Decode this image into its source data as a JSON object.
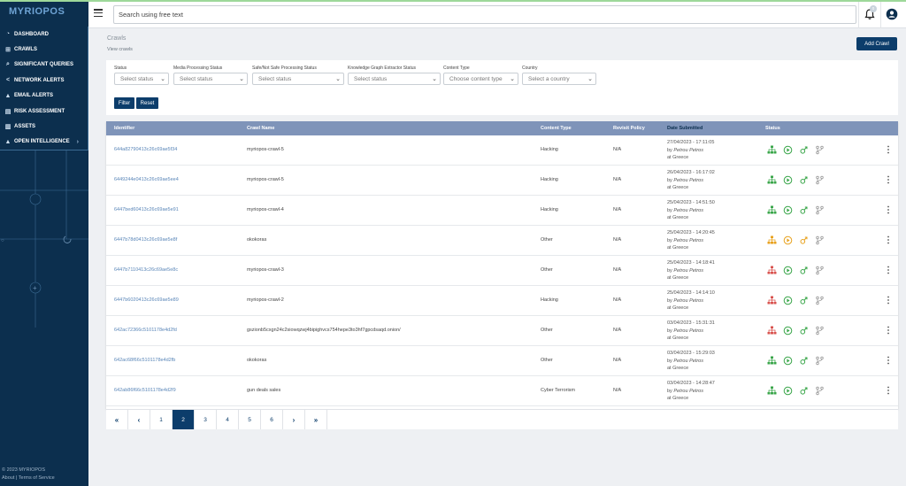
{
  "app": {
    "logo": "MYRIOPOS"
  },
  "sidebar": {
    "items": [
      {
        "label": "DASHBOARD",
        "icon": "gauge-icon",
        "glyph": "◔"
      },
      {
        "label": "CRAWLS",
        "icon": "sitemap-icon",
        "glyph": "⊞"
      },
      {
        "label": "SIGNIFICANT QUERIES",
        "icon": "search-icon",
        "glyph": "⌕"
      },
      {
        "label": "NETWORK ALERTS",
        "icon": "share-icon",
        "glyph": "<"
      },
      {
        "label": "EMAIL ALERTS",
        "icon": "warning-icon",
        "glyph": "▲"
      },
      {
        "label": "RISK ASSESSMENT",
        "icon": "checklist-icon",
        "glyph": "▤"
      },
      {
        "label": "ASSETS",
        "icon": "building-icon",
        "glyph": "▥"
      },
      {
        "label": "OPEN INTELLIGENCE",
        "icon": "warning-icon",
        "glyph": "▲"
      }
    ],
    "footer_copyright": "© 2023 MYRIOPOS",
    "footer_links": "About | Terms of Service"
  },
  "topbar": {
    "search_placeholder": "Search using free text",
    "notification_count": "0"
  },
  "page": {
    "title": "Crawls",
    "subtitle": "View crawls",
    "add_button": "Add Crawl"
  },
  "filters": {
    "status": {
      "label": "Status",
      "value": "Select status"
    },
    "media": {
      "label": "Media Processing Status",
      "value": "Select status"
    },
    "safe": {
      "label": "Safe/Not Safe Processing Status",
      "value": "Select status"
    },
    "kg": {
      "label": "Knowledge Graph Extractor Status",
      "value": "Select status"
    },
    "content_type": {
      "label": "Content Type",
      "value": "Choose content type"
    },
    "country": {
      "label": "Country",
      "value": "Select a country"
    },
    "filter_button": "Filter",
    "reset_button": "Reset"
  },
  "table": {
    "headers": {
      "identifier": "Identifier",
      "crawl_name": "Crawl Name",
      "content_type": "Content Type",
      "revisit_policy": "Revisit Policy",
      "date_submitted": "Date Submitted",
      "status": "Status"
    },
    "rows": [
      {
        "id": "644a82790413c26c69ae5f34",
        "name": "myriopos-crawl-5",
        "type": "Hacking",
        "revisit": "N/A",
        "date": "27/04/2023 - 17:11:05",
        "by_prefix": "by ",
        "by_name": "Petrou Petros",
        "location": "at Greece",
        "status_color": "#3aa64a",
        "extractor_color": "#3aa64a"
      },
      {
        "id": "6449244e0413c26c69ae5ee4",
        "name": "myriopos-crawl-5",
        "type": "Hacking",
        "revisit": "N/A",
        "date": "26/04/2023 - 16:17:02",
        "by_prefix": "by ",
        "by_name": "Petrou Petros",
        "location": "at Greece",
        "status_color": "#3aa64a",
        "extractor_color": "#3aa64a"
      },
      {
        "id": "6447bed60413c26c69ae5e91",
        "name": "myriopos-crawl-4",
        "type": "Hacking",
        "revisit": "N/A",
        "date": "25/04/2023 - 14:51:50",
        "by_prefix": "by ",
        "by_name": "Petrou Petros",
        "location": "at Greece",
        "status_color": "#3aa64a",
        "extractor_color": "#3aa64a"
      },
      {
        "id": "6447b78d0413c26c69ae5e8f",
        "name": "okokoras",
        "type": "Other",
        "revisit": "N/A",
        "date": "25/04/2023 - 14:20:45",
        "by_prefix": "by ",
        "by_name": "Petrou Petros",
        "location": "at Greece",
        "status_color": "#e8a21f",
        "extractor_color": "#e8a21f"
      },
      {
        "id": "6447b7110413c26c69ae5e8c",
        "name": "myriopos-crawl-3",
        "type": "Other",
        "revisit": "N/A",
        "date": "25/04/2023 - 14:18:41",
        "by_prefix": "by ",
        "by_name": "Petrou Petros",
        "location": "at Greece",
        "status_color": "#d9534f",
        "extractor_color": "#3aa64a"
      },
      {
        "id": "6447b6020413c26c69ae5e89",
        "name": "myriopos-crawl-2",
        "type": "Hacking",
        "revisit": "N/A",
        "date": "25/04/2023 - 14:14:10",
        "by_prefix": "by ",
        "by_name": "Petrou Petros",
        "location": "at Greece",
        "status_color": "#d9534f",
        "extractor_color": "#3aa64a"
      },
      {
        "id": "642ac72366c5101178e4d2fd",
        "name": "gszionb5cxgn24c2siowqzwj4bipighvcs754hepe3to3hf7gpcdsaqd.onion/",
        "type": "Other",
        "revisit": "N/A",
        "date": "03/04/2023 - 15:31:31",
        "by_prefix": "by ",
        "by_name": "Petrou Petros",
        "location": "at Greece",
        "status_color": "#d9534f",
        "extractor_color": "#3aa64a"
      },
      {
        "id": "642ac68f66c5101178e4d2fb",
        "name": "okokoras",
        "type": "Other",
        "revisit": "N/A",
        "date": "03/04/2023 - 15:29:03",
        "by_prefix": "by ",
        "by_name": "Petrou Petros",
        "location": "at Greece",
        "status_color": "#3aa64a",
        "extractor_color": "#3aa64a"
      },
      {
        "id": "642ab86f66c5101178e4d2f9",
        "name": "gun deals sales",
        "type": "Cyber Terrorism",
        "revisit": "N/A",
        "date": "03/04/2023 - 14:28:47",
        "by_prefix": "by ",
        "by_name": "Petrou Petros",
        "location": "at Greece",
        "status_color": "#3aa64a",
        "extractor_color": "#3aa64a"
      }
    ]
  },
  "pagination": {
    "first": "«",
    "prev": "‹",
    "next": "›",
    "last": "»",
    "pages": [
      "1",
      "2",
      "3",
      "4",
      "5",
      "6"
    ],
    "current": "2"
  },
  "colors": {
    "primary": "#0c3d6b",
    "sidebar": "#0c2f4e",
    "table_header": "#7f94b9",
    "link": "#5a86b8",
    "green": "#3aa64a",
    "orange": "#e8a21f",
    "red": "#d9534f"
  }
}
